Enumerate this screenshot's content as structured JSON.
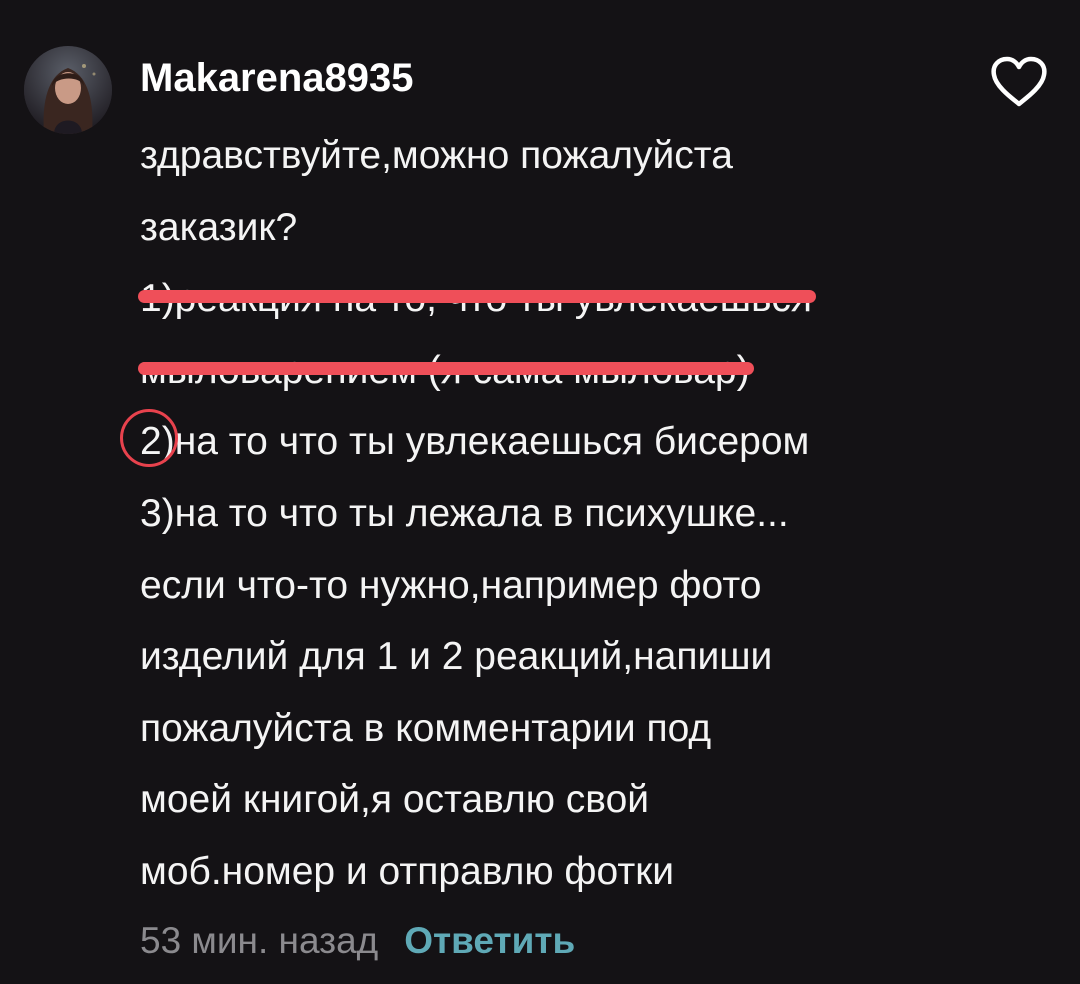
{
  "comment": {
    "avatar_icon": "user-avatar",
    "username": "Makarena8935",
    "like_icon": "heart-icon",
    "lines": [
      "здравствуйте,можно пожалуйста",
      "заказик?",
      "1)реакция на то, что ты увлекаешься",
      "мыловарением (я сама мыловар)",
      "2)на то что ты увлекаешься бисером",
      "3)на то что ты лежала в психушке...",
      "если что-то нужно,например фото",
      "изделий для 1 и 2 реакций,напиши",
      "пожалуйста в комментарии под",
      "моей книгой,я оставлю  свой",
      "моб.номер и отправлю фотки"
    ],
    "item2_number": "2",
    "item2_rest": ")на то что ты увлекаешься бисером",
    "timestamp": "53 мин. назад",
    "reply_label": "Ответить",
    "colors": {
      "background": "#141215",
      "strike": "#ef4f59",
      "circle": "#e8424d",
      "reply": "#5fa9b6",
      "timestamp": "#8b8a8e"
    }
  }
}
